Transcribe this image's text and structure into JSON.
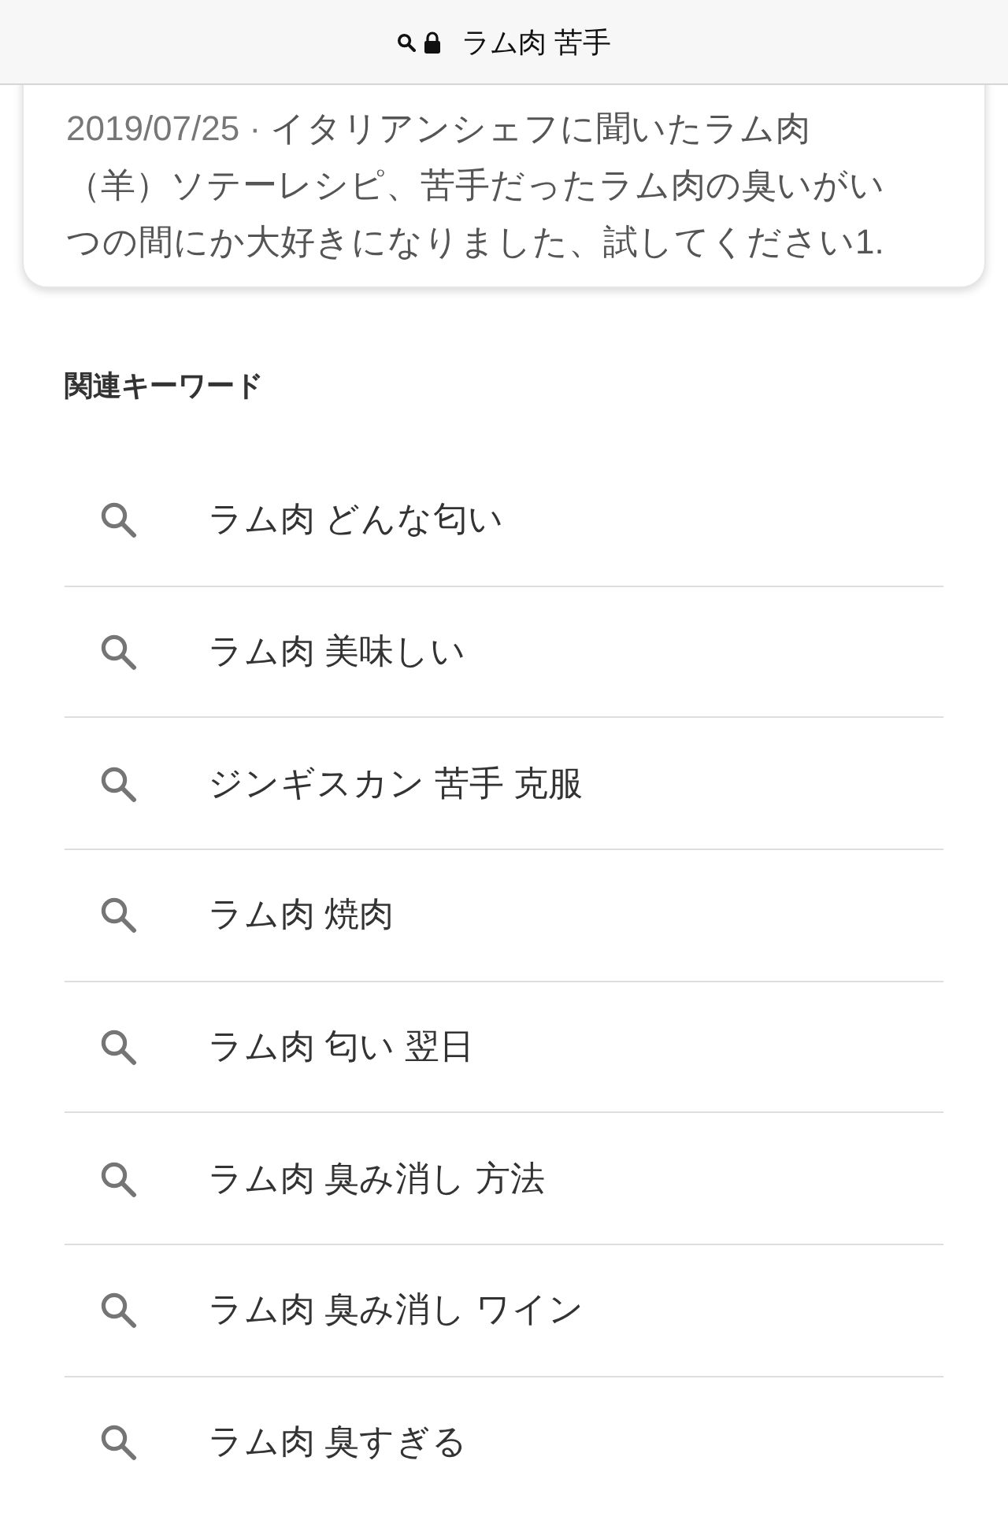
{
  "address_bar": {
    "query": "ラム肉 苦手"
  },
  "result": {
    "date": "2019/07/25 ·",
    "snippet": "イタリアンシェフに聞いたラム肉（羊）ソテーレシピ、苦手だったラム肉の臭いがいつの間にか大好きになりました、試してください1."
  },
  "related": {
    "title": "関連キーワード",
    "items": [
      "ラム肉 どんな匂い",
      "ラム肉 美味しい",
      "ジンギスカン 苦手 克服",
      "ラム肉 焼肉",
      "ラム肉 匂い 翌日",
      "ラム肉 臭み消し 方法",
      "ラム肉 臭み消し ワイン",
      "ラム肉 臭すぎる"
    ]
  }
}
